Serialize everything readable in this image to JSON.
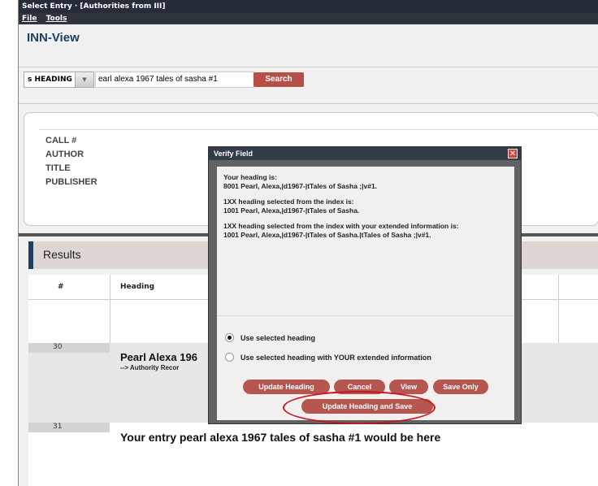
{
  "window": {
    "title": "Select Entry · [Authorities from III]",
    "menu": [
      "File",
      "Tools"
    ],
    "brand": "INN-View"
  },
  "search": {
    "index": "s HEADING",
    "query": "earl alexa    1967 tales of sasha #1",
    "button": "Search"
  },
  "detail": {
    "labels": [
      "CALL #",
      "AUTHOR",
      "TITLE",
      "PUBLISHER"
    ]
  },
  "results": {
    "title": "Results",
    "columns": [
      "#",
      "Heading"
    ],
    "rows": [
      {
        "num": "30",
        "title": "Pearl Alexa 196",
        "sub": "--> Authority Recor"
      },
      {
        "num": "31",
        "title": "Your entry pearl alexa    1967 tales of sasha #1 would be here",
        "sub": ""
      }
    ]
  },
  "dialog": {
    "title": "Verify Field",
    "close": "✕",
    "heading_label": "Your heading is:",
    "heading_value": "8001 Pearl, Alexa,|d1967-|tTales of Sasha ;|v#1.",
    "index_label": "1XX heading selected from the index is:",
    "index_value": "1001  Pearl, Alexa,|d1967-|tTales of Sasha.",
    "extended_label": "1XX heading selected from the index with your extended information is:",
    "extended_value": "1001  Pearl, Alexa,|d1967-|tTales of Sasha.|tTales of Sasha ;|v#1.",
    "options": [
      {
        "label": "Use selected heading",
        "selected": true
      },
      {
        "label": "Use selected heading with YOUR extended information",
        "selected": false
      }
    ],
    "buttons": {
      "update_heading": "Update Heading",
      "cancel": "Cancel",
      "view": "View",
      "save_only": "Save Only",
      "update_and_save": "Update Heading and Save"
    }
  },
  "colors": {
    "accent": "#b55650",
    "brand": "#1e3f62",
    "highlight": "#c8161f"
  }
}
